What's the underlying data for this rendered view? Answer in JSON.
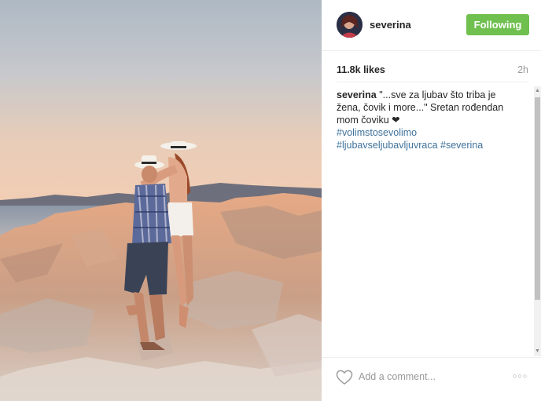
{
  "photo": {
    "icon": "beach-couple-photo"
  },
  "header": {
    "username": "severina",
    "follow_label": "Following",
    "follow_color": "#70c050",
    "avatar_icon": "profile-avatar"
  },
  "stats": {
    "likes": "11.8k likes",
    "time": "2h"
  },
  "caption": {
    "user": "severina",
    "text": "\"...sve za ljubav što triba je žena, čovik i more...\" Sretan rođendan mom čoviku ❤",
    "hashtags": [
      "#volimstosevolimo",
      "#ljubavseljubavljuvraca",
      "#severina"
    ]
  },
  "comment": {
    "placeholder": "Add a comment...",
    "heart_icon": "heart-outline-icon",
    "more_icon": "more-options-icon"
  },
  "colors": {
    "hashtag": "#3f729b",
    "text": "#262626",
    "muted": "#999999"
  }
}
